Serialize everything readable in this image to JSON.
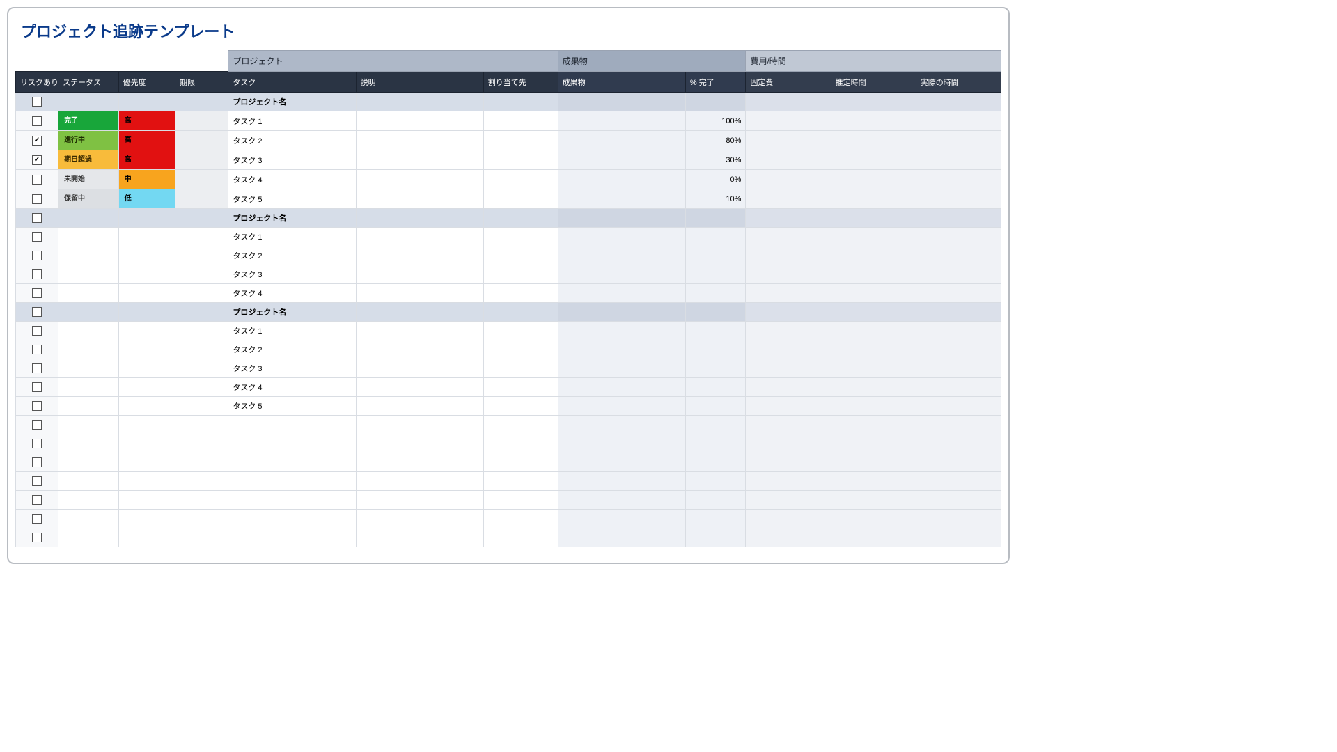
{
  "title": "プロジェクト追跡テンプレート",
  "groupHeaders": {
    "project": "プロジェクト",
    "deliverable": "成果物",
    "cost": "費用/時間"
  },
  "columns": {
    "risk": "リスクあり",
    "status": "ステータス",
    "priority": "優先度",
    "due": "期限",
    "task": "タスク",
    "desc": "説明",
    "assign": "割り当て先",
    "deliv": "成果物",
    "pct": "% 完了",
    "fixed": "固定費",
    "est": "推定時間",
    "act": "実際の時間"
  },
  "statusLabels": {
    "done": "完了",
    "progress": "進行中",
    "overdue": "期日超過",
    "notstart": "未開始",
    "hold": "保留中"
  },
  "priorityLabels": {
    "high": "高",
    "med": "中",
    "low": "低"
  },
  "sections": [
    {
      "name": "プロジェクト名",
      "rows": [
        {
          "risk": false,
          "status": "done",
          "priority": "high",
          "task": "タスク 1",
          "pct": "100%"
        },
        {
          "risk": true,
          "status": "progress",
          "priority": "high",
          "task": "タスク 2",
          "pct": "80%"
        },
        {
          "risk": true,
          "status": "overdue",
          "priority": "high",
          "task": "タスク 3",
          "pct": "30%"
        },
        {
          "risk": false,
          "status": "notstart",
          "priority": "med",
          "task": "タスク 4",
          "pct": "0%"
        },
        {
          "risk": false,
          "status": "hold",
          "priority": "low",
          "task": "タスク 5",
          "pct": "10%"
        }
      ]
    },
    {
      "name": "プロジェクト名",
      "rows": [
        {
          "risk": false,
          "task": "タスク 1"
        },
        {
          "risk": false,
          "task": "タスク 2"
        },
        {
          "risk": false,
          "task": "タスク 3"
        },
        {
          "risk": false,
          "task": "タスク 4"
        }
      ]
    },
    {
      "name": "プロジェクト名",
      "rows": [
        {
          "risk": false,
          "task": "タスク 1"
        },
        {
          "risk": false,
          "task": "タスク 2"
        },
        {
          "risk": false,
          "task": "タスク 3"
        },
        {
          "risk": false,
          "task": "タスク 4"
        },
        {
          "risk": false,
          "task": "タスク 5"
        }
      ]
    }
  ],
  "emptyRows": 7
}
